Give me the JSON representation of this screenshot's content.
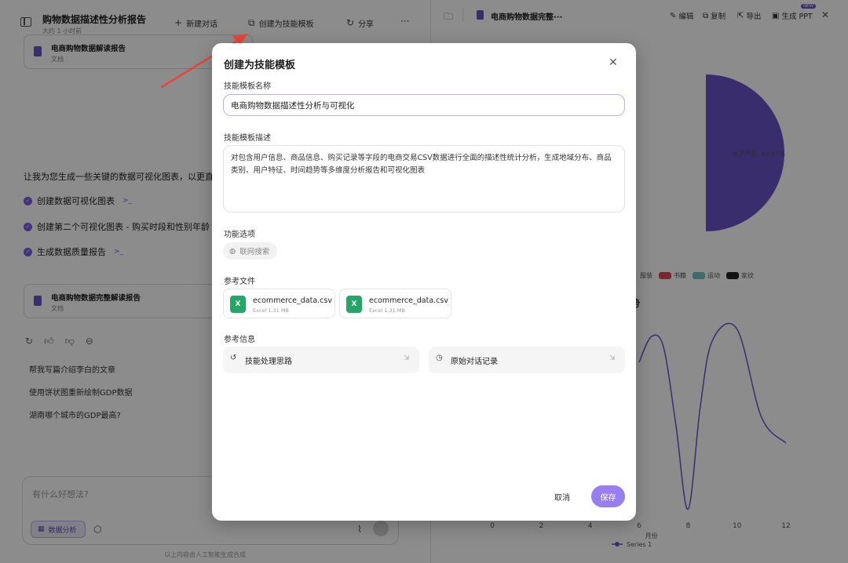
{
  "left": {
    "title": "购物数据描述性分析报告",
    "subtitle": "大约 1 小时前",
    "toolbar": {
      "new_chat": "新建对话",
      "create_template": "创建为技能模板",
      "share": "分享",
      "more": "···"
    },
    "doc_card_1": {
      "title": "电商购物数据解读报告",
      "type": "文档"
    },
    "message": "让我为您生成一些关键的数据可视化图表，以更直",
    "steps": [
      {
        "label": "创建数据可视化图表"
      },
      {
        "label": "创建第二个可视化图表 - 购买时段和性别年龄"
      },
      {
        "label": "生成数据质量报告"
      }
    ],
    "doc_card_2": {
      "title": "电商购物数据完整解读报告",
      "type": "文档"
    },
    "suggestions": [
      "帮我写篇介绍李白的文章",
      "使用饼状图重新绘制GDP数据",
      "湖南哪个城市的GDP最高?"
    ],
    "composer": {
      "placeholder": "有什么好想法?",
      "chip": "数据分析"
    },
    "disclaimer": "以上内容由人工智能生成合成"
  },
  "right": {
    "doc_title": "电商购物数据完整···",
    "actions": {
      "edit": "编辑",
      "copy": "复制",
      "export": "导出",
      "ppt": "生成 PPT",
      "new_badge": "NEW"
    },
    "pie_label": "电子产品: 49.97%",
    "legend": [
      {
        "name": "服装",
        "color": ""
      },
      {
        "name": "书籍",
        "color": "#e0464f"
      },
      {
        "name": "运动",
        "color": "#6cc3c4"
      },
      {
        "name": "家纹",
        "color": "#222222"
      }
    ],
    "chart2_title": "趋势",
    "chart_data": {
      "type": "line",
      "title": "趋势",
      "xlabel": "月份",
      "ylabel": "",
      "x_ticks": [
        "0",
        "2",
        "4",
        "6",
        "8",
        "10",
        "12"
      ],
      "xlim": [
        0,
        12
      ],
      "series": [
        {
          "name": "Series 1",
          "color": "#6b52c9",
          "points": [
            [
              6,
              8.2
            ],
            [
              6.5,
              9.6
            ],
            [
              7,
              9.0
            ],
            [
              7.5,
              4.8
            ],
            [
              8,
              0.2
            ],
            [
              8.5,
              5.8
            ],
            [
              9,
              9.4
            ],
            [
              10,
              10.0
            ],
            [
              11,
              5.2
            ],
            [
              12,
              3.8
            ]
          ]
        }
      ],
      "ylim": [
        0,
        10.5
      ]
    },
    "pie_color": "#6b52c9"
  },
  "modal": {
    "title": "创建为技能模板",
    "name_label": "技能模板名称",
    "name_value": "电商购物数据描述性分析与可视化",
    "desc_label": "技能模板描述",
    "desc_value": "对包含用户信息、商品信息、购买记录等字段的电商交易CSV数据进行全面的描述性统计分析，生成地域分布、商品类别、用户特征、时间趋势等多维度分析报告和可视化图表",
    "options_label": "功能选项",
    "web_search": "联网搜索",
    "files_label": "参考文件",
    "files": [
      {
        "name": "ecommerce_data.csv",
        "size": "Excel 1.31 MB"
      },
      {
        "name": "ecommerce_data.csv",
        "size": "Excel 1.31 MB"
      }
    ],
    "info_label": "参考信息",
    "info_items": [
      {
        "label": "技能处理思路"
      },
      {
        "label": "原始对话记录"
      }
    ],
    "cancel": "取消",
    "save": "保存"
  },
  "colors": {
    "accent": "#9a7ef0",
    "brand": "#6b52c9",
    "annotation_arrow": "#e8453c"
  }
}
